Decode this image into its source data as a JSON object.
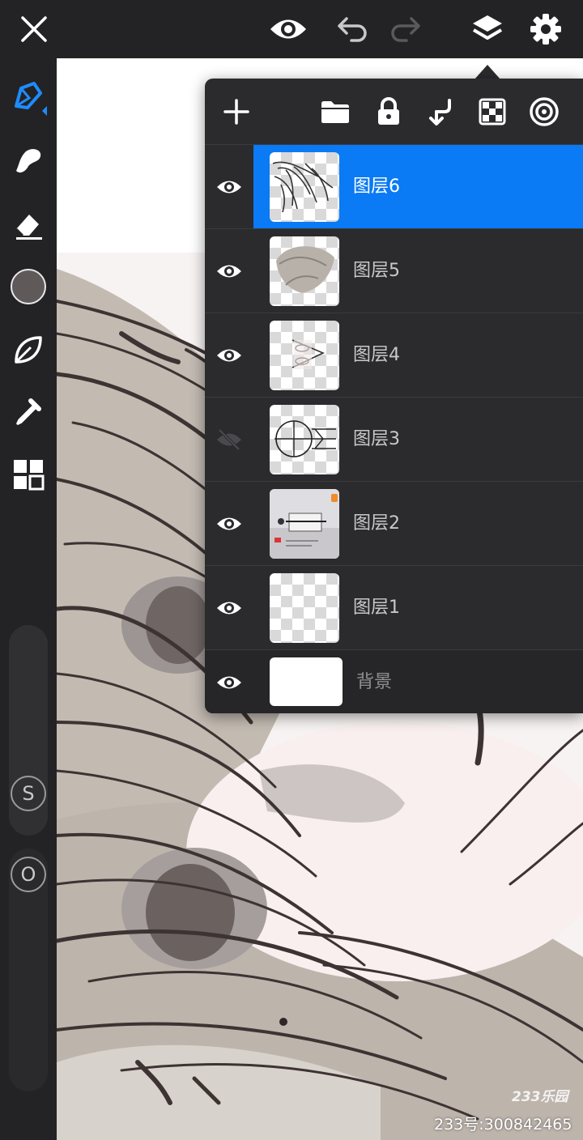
{
  "topbar": {
    "icons": [
      "close-icon",
      "eye-icon",
      "undo-icon",
      "redo-icon",
      "layers-icon",
      "gear-icon"
    ],
    "redo_enabled": false
  },
  "left_toolbar": {
    "tools": [
      "brush-icon",
      "smudge-icon",
      "eraser-icon",
      "color-icon",
      "leaf-icon",
      "eyedropper-icon",
      "grid-icon"
    ],
    "active_tool": "brush",
    "current_color": "#5f5a59",
    "size_label": "S",
    "opacity_label": "O"
  },
  "layers_panel": {
    "toolbar_icons": [
      "plus-icon",
      "folder-icon",
      "lock-icon",
      "merge-down-icon",
      "transparency-icon",
      "target-icon"
    ],
    "layers": [
      {
        "name": "图层6",
        "visible": true,
        "selected": true
      },
      {
        "name": "图层5",
        "visible": true,
        "selected": false
      },
      {
        "name": "图层4",
        "visible": true,
        "selected": false
      },
      {
        "name": "图层3",
        "visible": false,
        "selected": false
      },
      {
        "name": "图层2",
        "visible": true,
        "selected": false
      },
      {
        "name": "图层1",
        "visible": true,
        "selected": false
      }
    ],
    "background_layer": {
      "name": "背景",
      "visible": true
    }
  },
  "watermark": {
    "text": "233号:300842465",
    "logo": "233乐园"
  },
  "colors": {
    "accent": "#0a7af5",
    "panel": "#2b2b2e",
    "toolbar": "#232325"
  }
}
